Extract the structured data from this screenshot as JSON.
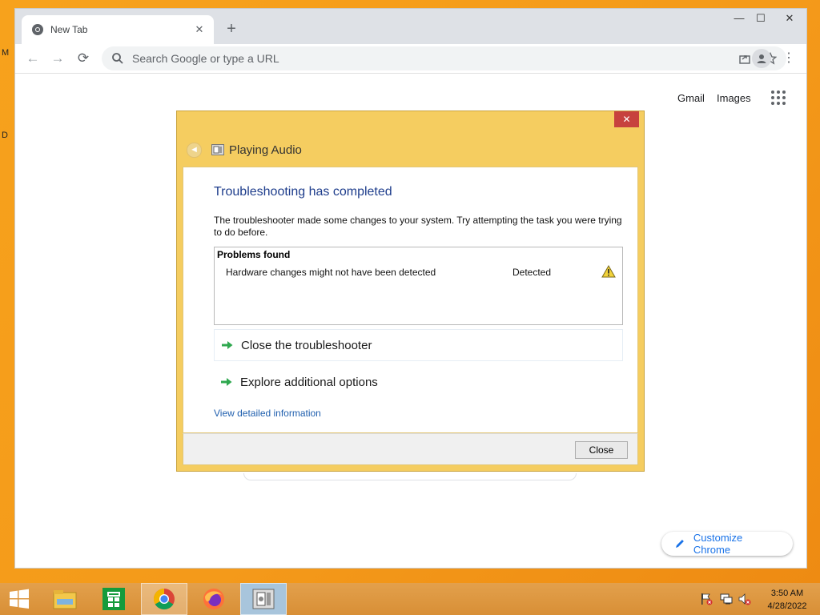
{
  "desktop": {
    "glyph_top": "M",
    "glyph_mid": "D"
  },
  "browser": {
    "tab": {
      "title": "New Tab",
      "close": "✕"
    },
    "new_tab": "+",
    "window_controls": {
      "minimize": "—",
      "maximize": "☐",
      "close": "✕"
    },
    "nav": {
      "back": "←",
      "forward": "→",
      "reload": "⟳"
    },
    "omnibox": {
      "placeholder": "Search Google or type a URL"
    },
    "menu": "⋮",
    "links": {
      "gmail": "Gmail",
      "images": "Images"
    },
    "customize": "Customize Chrome"
  },
  "dialog": {
    "close": "✕",
    "title": "Playing Audio",
    "heading": "Troubleshooting has completed",
    "description": "The troubleshooter made some changes to your system. Try attempting the task you were trying to do before.",
    "problems": {
      "header": "Problems found",
      "items": [
        {
          "text": "Hardware changes might not have been detected",
          "status": "Detected",
          "icon": "warning-icon"
        }
      ]
    },
    "options": [
      {
        "label": "Close the troubleshooter",
        "icon": "green-arrow-icon"
      },
      {
        "label": "Explore additional options",
        "icon": "green-arrow-icon"
      }
    ],
    "detail_link": "View detailed information",
    "button": "Close"
  },
  "taskbar": {
    "items": [
      "start-icon",
      "file-explorer-icon",
      "store-icon",
      "chrome-icon",
      "firefox-icon",
      "troubleshooter-icon"
    ],
    "tray": [
      "action-center-flag-icon",
      "network-icon",
      "volume-muted-icon"
    ],
    "time": "3:50 AM",
    "date": "4/28/2022"
  },
  "colors": {
    "desktop": "#f49a1a",
    "dialog_frame": "#f5cd60",
    "dialog_heading": "#1e3d8c",
    "link": "#1f5fae",
    "close_red": "#c42b1c"
  }
}
